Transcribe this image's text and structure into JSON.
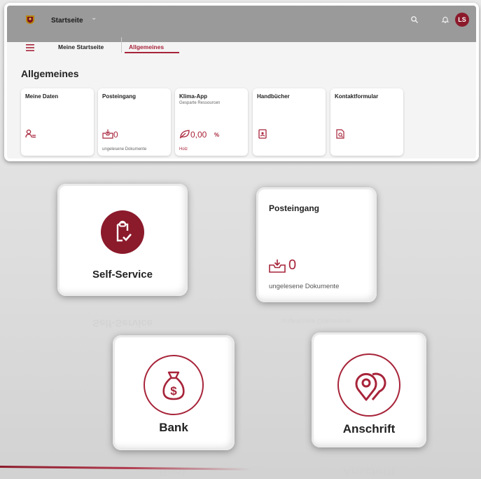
{
  "header": {
    "app_title": "Startseite",
    "avatar_initials": "LS",
    "brand_color": "#8b1a2b"
  },
  "nav": {
    "tabs": [
      {
        "label": "Meine Startseite",
        "active": false
      },
      {
        "label": "Allgemeines",
        "active": true
      }
    ]
  },
  "section_title": "Allgemeines",
  "tiles": [
    {
      "title": "Meine Daten",
      "icon": "user-list-icon"
    },
    {
      "title": "Posteingang",
      "value": "0",
      "footer": "ungelesene Dokumente",
      "icon": "inbox-icon"
    },
    {
      "title": "Klima-App",
      "subtitle": "Gesparte Ressourcen",
      "value": "0,00",
      "unit": "%",
      "footer": "Holz",
      "icon": "leaf-icon"
    },
    {
      "title": "Handbücher",
      "icon": "manual-icon"
    },
    {
      "title": "Kontaktformular",
      "icon": "contact-form-icon"
    }
  ],
  "showcase": {
    "self_service": {
      "label": "Self-Service",
      "icon": "clipboard-check-icon"
    },
    "posteingang": {
      "title": "Posteingang",
      "value": "0",
      "footer": "ungelesene Dokumente",
      "icon": "inbox-icon"
    },
    "bank": {
      "label": "Bank",
      "icon": "money-bag-icon"
    },
    "anschrift": {
      "label": "Anschrift",
      "icon": "location-pin-icon"
    }
  }
}
